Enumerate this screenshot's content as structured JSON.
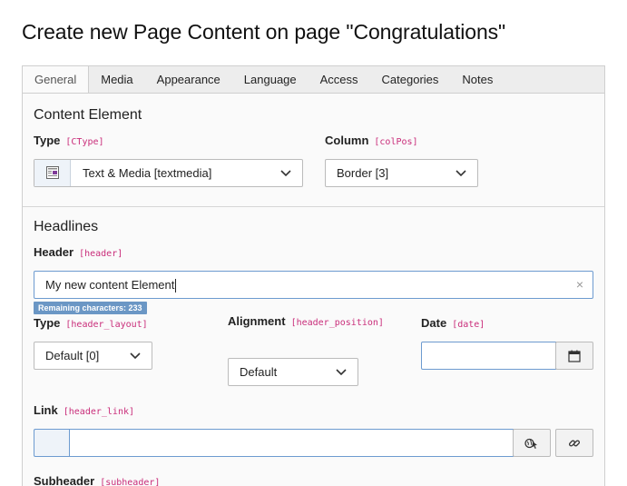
{
  "page_title": "Create new Page Content on page \"Congratulations\"",
  "tabs": [
    {
      "label": "General",
      "active": true
    },
    {
      "label": "Media"
    },
    {
      "label": "Appearance"
    },
    {
      "label": "Language"
    },
    {
      "label": "Access"
    },
    {
      "label": "Categories"
    },
    {
      "label": "Notes"
    }
  ],
  "content_element": {
    "title": "Content Element",
    "type": {
      "label": "Type",
      "key": "[CType]",
      "value": "Text & Media [textmedia]"
    },
    "column": {
      "label": "Column",
      "key": "[colPos]",
      "value": "Border [3]"
    }
  },
  "headlines": {
    "title": "Headlines",
    "header": {
      "label": "Header",
      "key": "[header]",
      "value": "My new content Element",
      "remaining": "Remaining characters: 233"
    },
    "header_type": {
      "label": "Type",
      "key": "[header_layout]",
      "value": "Default [0]"
    },
    "alignment": {
      "label": "Alignment",
      "key": "[header_position]",
      "value": "Default"
    },
    "date": {
      "label": "Date",
      "key": "[date]",
      "value": ""
    },
    "link": {
      "label": "Link",
      "key": "[header_link]",
      "value": ""
    },
    "subheader": {
      "label": "Subheader",
      "key": "[subheader]"
    }
  },
  "colors": {
    "accent": "#6b97c5",
    "key": "#c92d7a",
    "input_border": "#6d9bd0"
  }
}
